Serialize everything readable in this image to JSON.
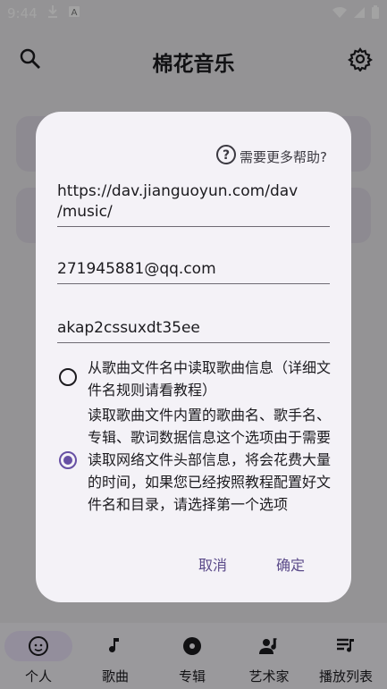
{
  "status_bar": {
    "time": "9:44"
  },
  "app_bar": {
    "title": "棉花音乐"
  },
  "dialog": {
    "help_text": "需要更多帮助?",
    "url_value": "https://dav.jianguoyun.com/dav/music/",
    "url_line1": "https://dav.jianguoyun.com/dav",
    "url_line2": "/music/",
    "username_value": "271945881@qq.com",
    "password_value": "akap2cssuxdt35ee",
    "options": [
      {
        "text": "从歌曲文件名中读取歌曲信息（详细文件名规则请看教程）",
        "selected": false
      },
      {
        "text": "读取歌曲文件内置的歌曲名、歌手名、专辑、歌词数据信息这个选项由于需要读取网络文件头部信息，将会花费大量的时间，如果您已经按照教程配置好文件名和目录，请选择第一个选项",
        "selected": true
      }
    ],
    "cancel_label": "取消",
    "confirm_label": "确定"
  },
  "bottom_nav": {
    "items": [
      {
        "label": "个人",
        "icon": "face-icon",
        "active": true
      },
      {
        "label": "歌曲",
        "icon": "music-note-icon",
        "active": false
      },
      {
        "label": "专辑",
        "icon": "album-icon",
        "active": false
      },
      {
        "label": "艺术家",
        "icon": "artist-icon",
        "active": false
      },
      {
        "label": "播放列表",
        "icon": "playlist-icon",
        "active": false
      }
    ]
  },
  "colors": {
    "accent": "#6750a4",
    "dialog_bg": "#f4f2f7"
  }
}
